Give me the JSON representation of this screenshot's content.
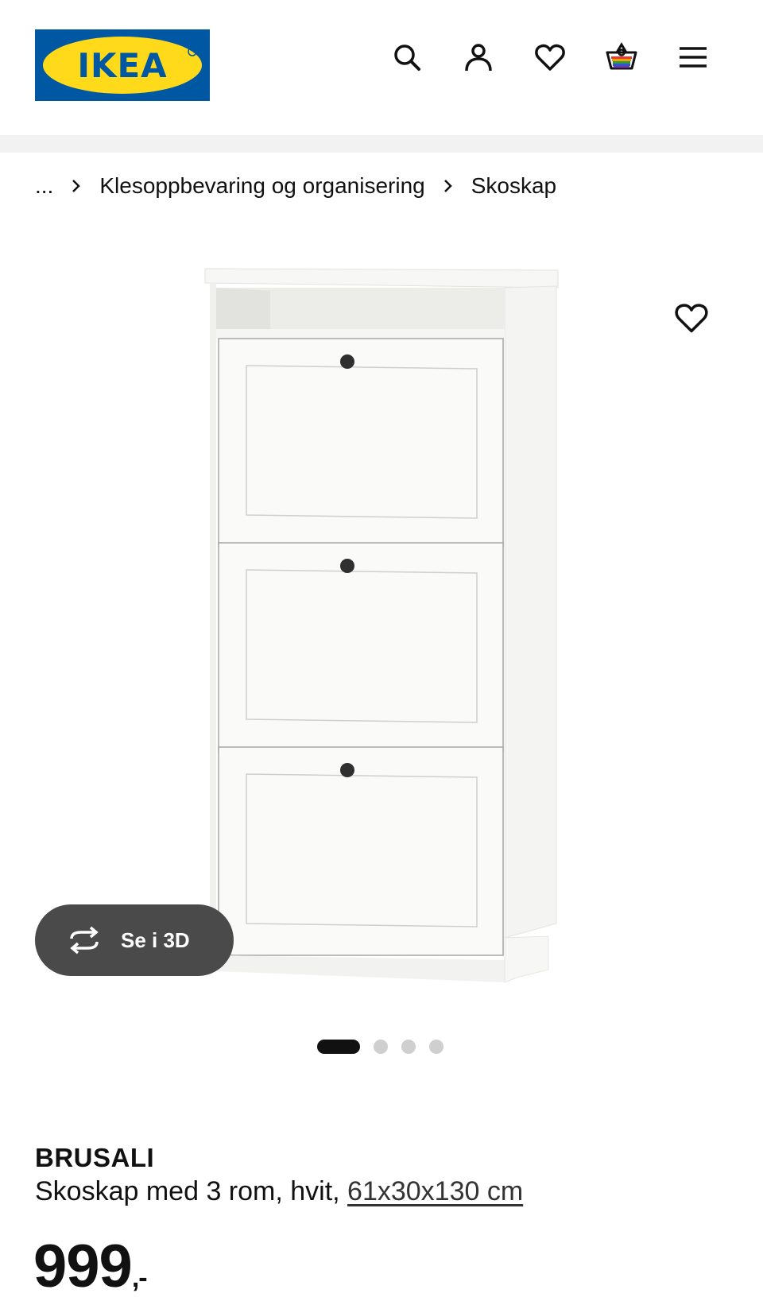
{
  "header": {
    "logo_text": "IKEA",
    "brand_colors": {
      "blue": "#0058a3",
      "yellow": "#ffda1a"
    },
    "icons": [
      "search-icon",
      "account-icon",
      "favourites-icon",
      "cart-icon",
      "menu-icon"
    ]
  },
  "breadcrumb": {
    "items": [
      "...",
      "Klesoppbevaring og organisering",
      "Skoskap"
    ]
  },
  "gallery": {
    "view_3d_label": "Se i 3D",
    "slides_total": 4,
    "active_slide": 1
  },
  "product": {
    "name": "BRUSALI",
    "description": "Skoskap med 3 rom, hvit, ",
    "dimensions": "61x30x130 cm",
    "price": "999",
    "price_suffix": ",-"
  }
}
